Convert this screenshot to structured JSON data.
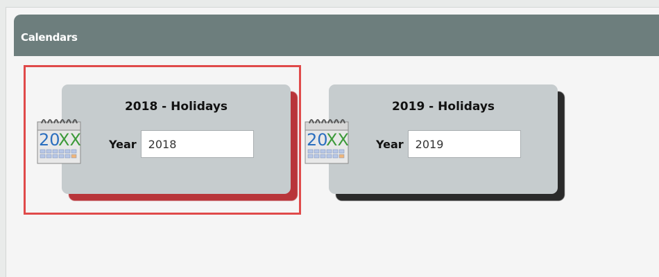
{
  "panel": {
    "title": "Calendars"
  },
  "icon_text": "20XX",
  "cards": [
    {
      "title": "2018 - Holidays",
      "year_label": "Year",
      "year_value": "2018",
      "selected": true
    },
    {
      "title": "2019 - Holidays",
      "year_label": "Year",
      "year_value": "2019",
      "selected": false
    }
  ],
  "colors": {
    "header_bg": "#6d7e7d",
    "card_bg": "#c6ccce",
    "selection_border": "#e04a4a",
    "shadow_selected": "#b8353a",
    "shadow_default": "#2a2a2a"
  }
}
